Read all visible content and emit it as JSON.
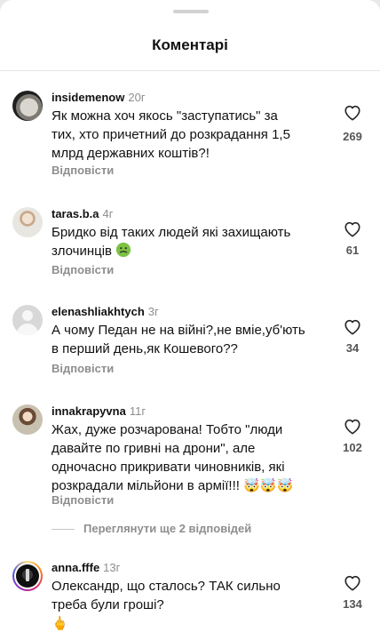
{
  "header": {
    "title": "Коментарі"
  },
  "comments": [
    {
      "username": "insidemenow",
      "time": "20г",
      "text": "Як можна хоч якось \"заступатись\" за\nтих, хто причетний до розкрадання 1,5\nмлрд державних коштів?!",
      "reply_label": "Відповісти",
      "likes": "269"
    },
    {
      "username": "taras.b.a",
      "time": "4г",
      "text": "Бридко від таких людей які захищають\nзлочинців",
      "reply_label": "Відповісти",
      "likes": "61"
    },
    {
      "username": "elenashliakhtych",
      "time": "3г",
      "text": "А чому Педан не на війні?,не вміе,уб'ють\nв перший день,як Кошевого??",
      "reply_label": "Відповісти",
      "likes": "34"
    },
    {
      "username": "innakrapyvna",
      "time": "11г",
      "text": "Жах, дуже розчарована! Тобто \"люди\nдавайте по гривні на дрони\", але\nодночасно прикривати чиновників, які\nрозкрадали мільйони в армії!!!",
      "emoji_after": "🤯🤯🤯",
      "reply_label": "Відповісти",
      "likes": "102"
    },
    {
      "username": "anna.fffe",
      "time": "13г",
      "text": "Олександр, що сталось? ТАК сильно\nтреба були гроші?",
      "emoji_line": "🖕",
      "likes": "134"
    }
  ],
  "view_more": {
    "label": "Переглянути ще 2 відповідей"
  },
  "icons": {
    "like": "heart-outline-icon"
  },
  "colors": {
    "secondary_text": "#8e8e8e",
    "background": "#ffffff"
  }
}
